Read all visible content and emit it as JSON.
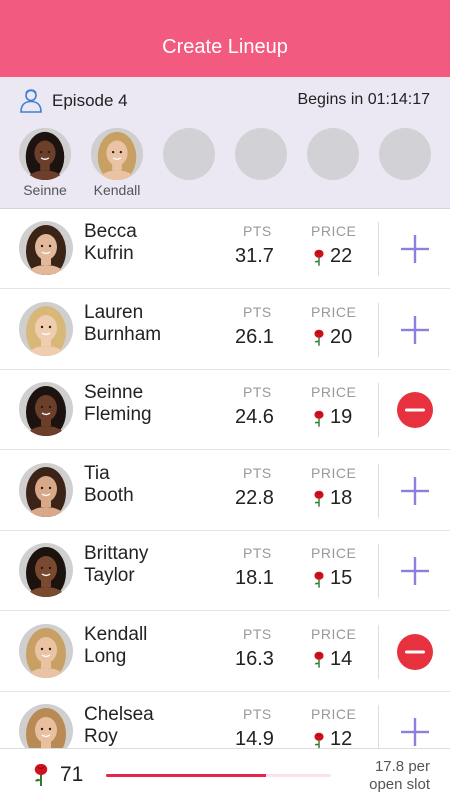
{
  "header": {
    "title": "Create Lineup"
  },
  "episode": {
    "title": "Episode 4",
    "begins": "Begins in 01:14:17"
  },
  "slots": [
    {
      "name": "Seinne",
      "skin": "#6b3f2a",
      "hair": "#1c1210",
      "filled": true
    },
    {
      "name": "Kendall",
      "skin": "#e9c3a3",
      "hair": "#c9a063",
      "filled": true
    },
    {
      "name": "",
      "filled": false
    },
    {
      "name": "",
      "filled": false
    },
    {
      "name": "",
      "filled": false
    },
    {
      "name": "",
      "filled": false
    }
  ],
  "labels": {
    "pts": "PTS",
    "price": "PRICE"
  },
  "contestants": [
    {
      "first": "Becca",
      "last": "Kufrin",
      "pts": "31.7",
      "price": "22",
      "selected": false,
      "skin": "#e2b89a",
      "hair": "#3a2416"
    },
    {
      "first": "Lauren",
      "last": "Burnham",
      "pts": "26.1",
      "price": "20",
      "selected": false,
      "skin": "#efcdb0",
      "hair": "#d8b878"
    },
    {
      "first": "Seinne",
      "last": "Fleming",
      "pts": "24.6",
      "price": "19",
      "selected": true,
      "skin": "#6b3f2a",
      "hair": "#1c1210"
    },
    {
      "first": "Tia",
      "last": "Booth",
      "pts": "22.8",
      "price": "18",
      "selected": false,
      "skin": "#d9a888",
      "hair": "#3b2417"
    },
    {
      "first": "Brittany",
      "last": "Taylor",
      "pts": "18.1",
      "price": "15",
      "selected": false,
      "skin": "#7a4a30",
      "hair": "#1d130e"
    },
    {
      "first": "Kendall",
      "last": "Long",
      "pts": "16.3",
      "price": "14",
      "selected": true,
      "skin": "#e9c3a3",
      "hair": "#c9a063"
    },
    {
      "first": "Chelsea",
      "last": "Roy",
      "pts": "14.9",
      "price": "12",
      "selected": false,
      "skin": "#e8c0a0",
      "hair": "#b88a54"
    }
  ],
  "footer": {
    "budget": "71",
    "budget_fraction": 0.71,
    "avg_value": "17.8",
    "avg_per": "per",
    "avg_sub": "open slot"
  },
  "colors": {
    "accent": "#f25a80",
    "add": "#8b7fe0",
    "remove": "#e8313f",
    "rose": "#d0101e",
    "bar": "#e8234f"
  }
}
